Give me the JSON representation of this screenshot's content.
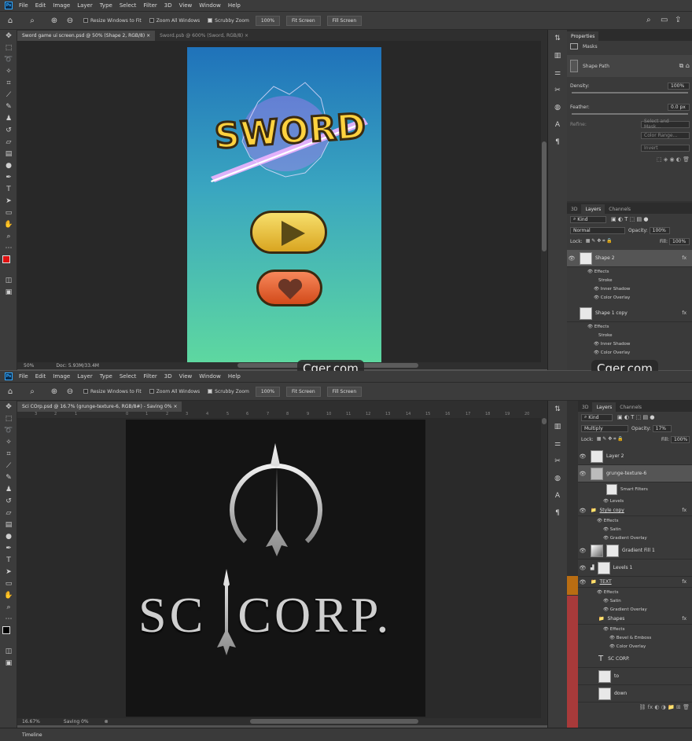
{
  "menu": [
    "File",
    "Edit",
    "Image",
    "Layer",
    "Type",
    "Select",
    "Filter",
    "3D",
    "View",
    "Window",
    "Help"
  ],
  "app_icon": "Ps",
  "options": {
    "resize_windows": "Resize Windows to Fit",
    "zoom_all": "Zoom All Windows",
    "scrubby_zoom": "Scrubby Zoom",
    "zoom_pct": "100%",
    "fit_screen": "Fit Screen",
    "fill_screen": "Fill Screen"
  },
  "top": {
    "tabs": [
      "Sword game ui screen.psd @ 50% (Shape 2, RGB/8)",
      "Sword.psb @ 600% (Sword, RGB/8)"
    ],
    "zoom": "50%",
    "doc": "Doc: 5.93M/33.4M",
    "art_title": "SWORD",
    "properties": {
      "title": "Properties",
      "masks": "Masks",
      "shape_path": "Shape Path",
      "density_label": "Density:",
      "density_value": "100%",
      "feather_label": "Feather:",
      "feather_value": "0.0 px",
      "refine": "Refine:",
      "select_mask": "Select and Mask...",
      "color_range": "Color Range...",
      "invert": "Invert"
    },
    "layers_tabs": [
      "3D",
      "Layers",
      "Channels"
    ],
    "kind": "Kind",
    "blend": "Normal",
    "opacity_label": "Opacity:",
    "opacity": "100%",
    "lock": "Lock:",
    "fill_label": "Fill:",
    "fill": "100%",
    "layers": [
      {
        "name": "Shape 2",
        "effects": [
          "Effects",
          "Stroke",
          "Inner Shadow",
          "Color Overlay"
        ]
      },
      {
        "name": "Shape 1 copy",
        "effects": [
          "Effects",
          "Stroke",
          "Inner Shadow",
          "Color Overlay"
        ]
      }
    ],
    "fx": "fx"
  },
  "bottom": {
    "tab": "Sci COrp.psd @ 16.7% (grunge-texture-6, RGB/8#) - Saving 0%",
    "ruler_ticks": [
      "3",
      "2",
      "1",
      "0",
      "1",
      "2",
      "3",
      "4",
      "5",
      "6",
      "7",
      "8",
      "9",
      "10",
      "11",
      "12",
      "13",
      "14",
      "15",
      "16",
      "17",
      "18",
      "19",
      "20",
      "21",
      "22"
    ],
    "zoom": "16.67%",
    "saving": "Saving 0%",
    "logo_text": "SC  CORP.",
    "layers_tabs": [
      "3D",
      "Layers",
      "Channels"
    ],
    "kind": "Kind",
    "blend": "Multiply",
    "opacity_label": "Opacity:",
    "opacity": "17%",
    "lock": "Lock:",
    "fill_label": "Fill:",
    "fill": "100%",
    "layers": [
      {
        "name": "Layer 2",
        "type": "layer"
      },
      {
        "name": "grunge-texture-6",
        "type": "smart",
        "subs": [
          "Smart Filters",
          "Levels"
        ]
      },
      {
        "name": "Style copy",
        "type": "group",
        "subs": [
          "Effects",
          "Satin",
          "Gradient Overlay"
        ]
      },
      {
        "name": "Gradient Fill 1",
        "type": "fill"
      },
      {
        "name": "Levels 1",
        "type": "adj"
      },
      {
        "name": "TEXT",
        "type": "group",
        "subs": [
          "Effects",
          "Satin",
          "Gradient Overlay"
        ]
      },
      {
        "name": "Shapes",
        "type": "group",
        "subs": [
          "Effects",
          "Bevel & Emboss",
          "Color Overlay"
        ]
      },
      {
        "name": "SC  CORP.",
        "type": "text"
      },
      {
        "name": "to",
        "type": "layer"
      },
      {
        "name": "down",
        "type": "layer"
      }
    ],
    "timeline": "Timeline"
  },
  "watermark": "Cger.com",
  "colors": {
    "accent": "#31a8ff",
    "fg": "#e01010",
    "bg": "#ffffff"
  }
}
